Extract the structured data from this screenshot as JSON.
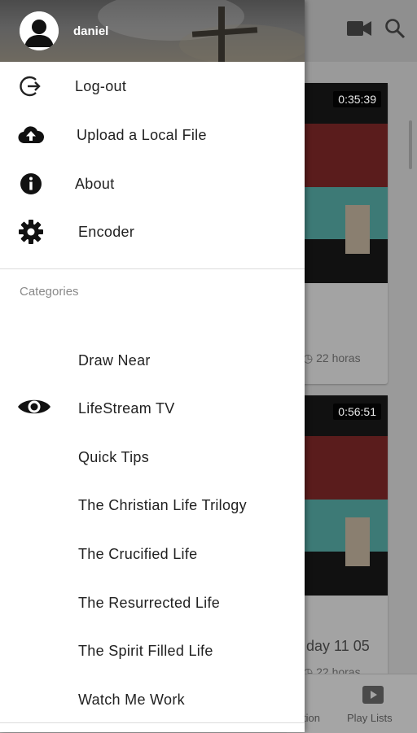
{
  "user": {
    "name": "daniel"
  },
  "menu": [
    {
      "label": "Log-out",
      "icon": "logout-icon"
    },
    {
      "label": "Upload a Local File",
      "icon": "cloud-upload-icon"
    },
    {
      "label": "About",
      "icon": "info-icon"
    },
    {
      "label": "Encoder",
      "icon": "gear-icon"
    }
  ],
  "categories": {
    "title": "Categories",
    "items": [
      {
        "label": "Draw Near"
      },
      {
        "label": "LifeStream TV",
        "icon": "eye-icon"
      },
      {
        "label": "Quick Tips"
      },
      {
        "label": "The Christian Life Trilogy"
      },
      {
        "label": "The Crucified Life"
      },
      {
        "label": "The Resurrected Life"
      },
      {
        "label": "The Spirit Filled Life"
      },
      {
        "label": "Watch Me Work"
      }
    ]
  },
  "background": {
    "videos": [
      {
        "duration": "0:35:39",
        "age": "22 horas"
      },
      {
        "duration": "0:56:51",
        "title_fragment": "day 11 05",
        "age": "22 horas"
      }
    ],
    "bottom_tabs": [
      "tion",
      "Play Lists"
    ]
  }
}
